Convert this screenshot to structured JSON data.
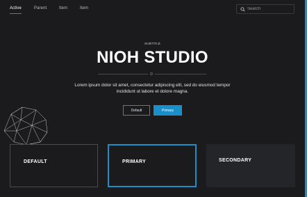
{
  "nav": {
    "items": [
      {
        "label": "Active",
        "active": true
      },
      {
        "label": "Parent",
        "active": false
      },
      {
        "label": "Item",
        "active": false
      },
      {
        "label": "Item",
        "active": false
      }
    ],
    "search": {
      "placeholder": "Search",
      "icon": "search-icon"
    }
  },
  "hero": {
    "subtitle": "SUBTITLE",
    "title": "NIOH STUDIO",
    "description": "Lorem ipsum dolor sit amet, consectetur adipiscing elit, sed do eiusmod tempor incididunt ut labore et dolore magna.",
    "buttons": {
      "default_label": "Default",
      "primary_label": "Primary"
    }
  },
  "cards": [
    {
      "label": "DEFAULT"
    },
    {
      "label": "PRIMARY"
    },
    {
      "label": "SECONDARY"
    }
  ],
  "colors": {
    "background": "#1b1b1d",
    "accent": "#1a8fc9",
    "card_secondary_bg": "#242528",
    "text": "#ffffff"
  }
}
